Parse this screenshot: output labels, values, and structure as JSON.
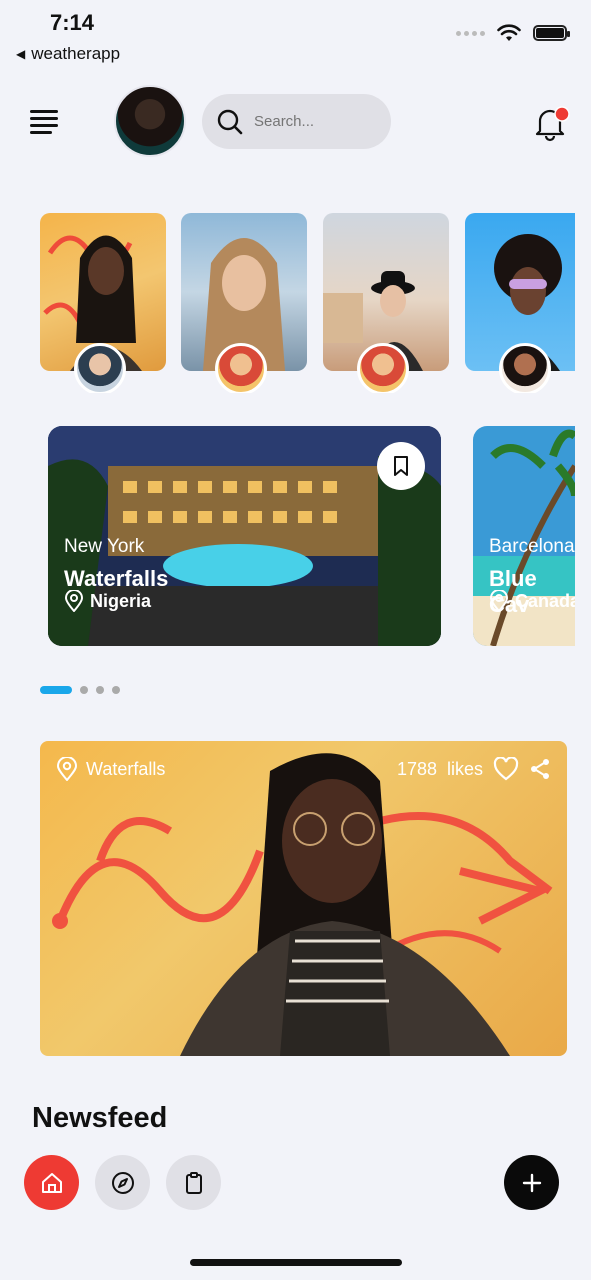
{
  "status_bar": {
    "time": "7:14",
    "back_app": "weatherapp"
  },
  "header": {
    "search_placeholder": "Search..."
  },
  "stories": [
    {
      "id": "story-1"
    },
    {
      "id": "story-2"
    },
    {
      "id": "story-3"
    },
    {
      "id": "story-4"
    }
  ],
  "destinations": [
    {
      "city": "New York",
      "name": "Waterfalls",
      "country": "Nigeria"
    },
    {
      "city": "Barcelona",
      "name": "Blue Cav",
      "country": "Canada"
    }
  ],
  "carousel": {
    "active_index": 0,
    "count": 4
  },
  "post": {
    "location": "Waterfalls",
    "likes_count": "1788",
    "likes_label": "likes"
  },
  "newsfeed": {
    "title": "Newsfeed"
  },
  "colors": {
    "accent_red": "#ee3a33",
    "accent_blue": "#1aa7ea",
    "notification_dot": "#ee3a33"
  },
  "icons": [
    "menu-icon",
    "search-icon",
    "bell-icon",
    "bookmark-icon",
    "location-pin-icon",
    "heart-icon",
    "share-icon",
    "home-icon",
    "compass-icon",
    "clipboard-icon",
    "plus-icon"
  ]
}
